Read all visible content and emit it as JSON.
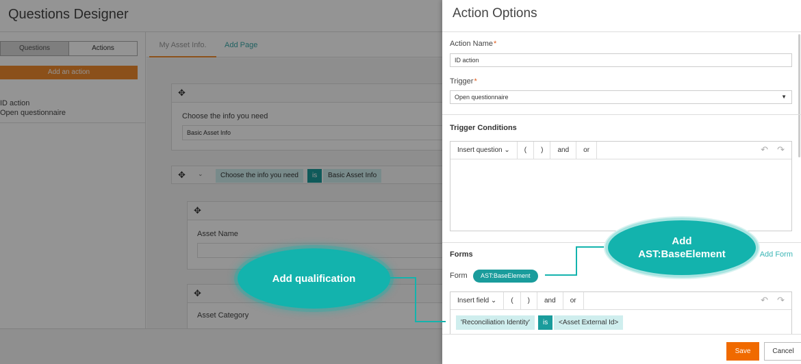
{
  "designer": {
    "title": "Questions Designer",
    "toggle": {
      "questions": "Questions",
      "actions": "Actions"
    },
    "add_action": "Add an action",
    "action_item": {
      "name": "ID action",
      "trigger": "Open questionnaire"
    },
    "tabs": {
      "page": "My Asset Info.",
      "add_page": "Add Page"
    },
    "card1": {
      "label": "Choose the info you need",
      "value": "Basic Asset Info"
    },
    "condition_chips": {
      "left": "Choose the info you need",
      "op": "is",
      "right": "Basic Asset Info"
    },
    "card2": {
      "label": "Asset Name"
    },
    "card3": {
      "label": "Asset Category"
    }
  },
  "panel": {
    "title": "Action Options",
    "action_name": {
      "label": "Action Name",
      "required": "*",
      "value": "ID action"
    },
    "trigger": {
      "label": "Trigger",
      "required": "*",
      "value": "Open questionnaire"
    },
    "trigger_conditions": {
      "heading": "Trigger Conditions",
      "toolbar": {
        "insert": "Insert question",
        "open_paren": "(",
        "close_paren": ")",
        "and": "and",
        "or": "or"
      }
    },
    "forms": {
      "heading": "Forms",
      "add_form": "Add Form",
      "form_label": "Form",
      "form_value": "AST:BaseElement",
      "toolbar": {
        "insert": "Insert field",
        "open_paren": "(",
        "close_paren": ")",
        "and": "and",
        "or": "or"
      },
      "condition": {
        "field": "'Reconciliation Identity'",
        "op": "is",
        "value": "<Asset External Id>"
      }
    },
    "footer": {
      "save": "Save",
      "cancel": "Cancel"
    }
  },
  "callouts": {
    "qualification": "Add qualification",
    "add_line1": "Add",
    "add_line2": "AST:BaseElement"
  },
  "colors": {
    "accent": "#f06a00",
    "teal": "#1a9c9c",
    "callout": "#13b3ad"
  }
}
